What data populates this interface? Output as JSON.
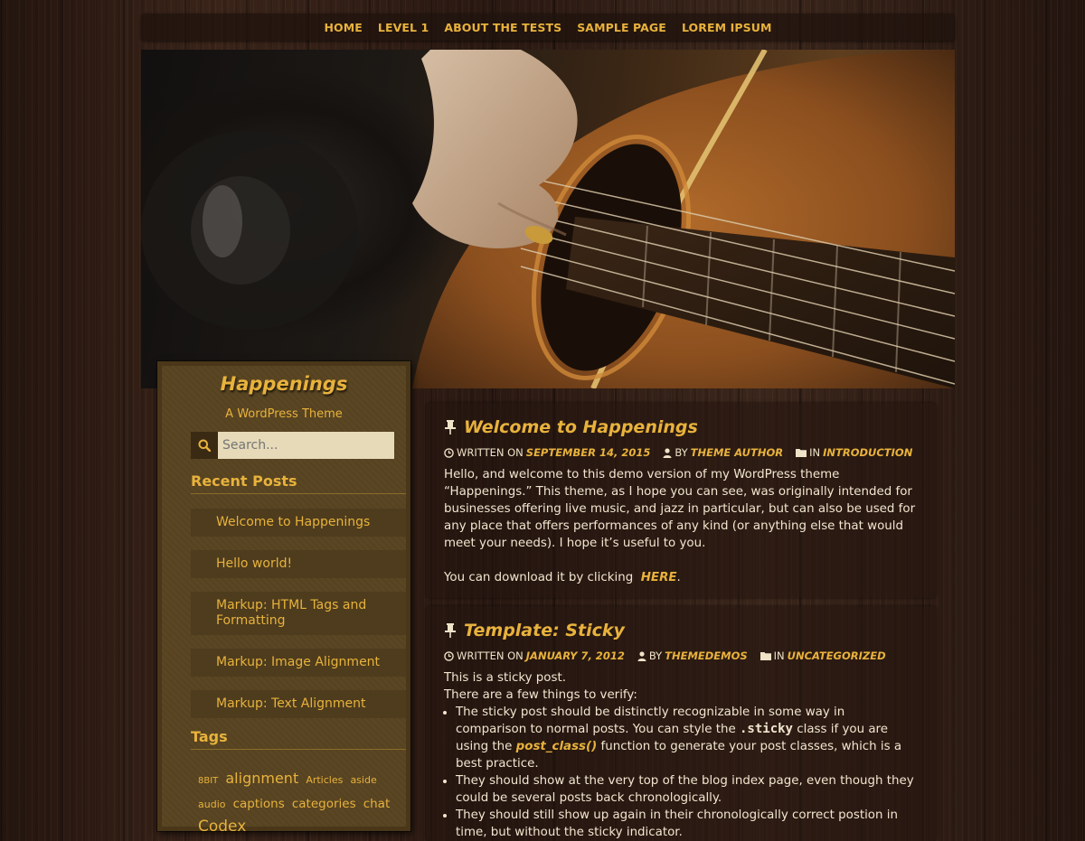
{
  "nav": {
    "items": [
      "HOME",
      "LEVEL 1",
      "ABOUT THE TESTS",
      "SAMPLE PAGE",
      "LOREM IPSUM"
    ]
  },
  "site": {
    "title": "Happenings",
    "tagline": "A WordPress Theme"
  },
  "search": {
    "placeholder": "Search...",
    "icon": "search-icon"
  },
  "recent_posts": {
    "title": "Recent Posts",
    "items": [
      "Welcome to Happenings",
      "Hello world!",
      "Markup: HTML Tags and Formatting",
      "Markup: Image Alignment",
      "Markup: Text Alignment"
    ]
  },
  "tags": {
    "title": "Tags",
    "items": [
      "8BIT",
      "alignment",
      "Articles",
      "aside",
      "audio",
      "captions",
      "categories",
      "chat",
      "Codex"
    ]
  },
  "posts": [
    {
      "title": "Welcome to Happenings",
      "meta": {
        "written_on_label": "WRITTEN ON",
        "date": "SEPTEMBER 14, 2015",
        "by_label": "BY",
        "author": "THEME AUTHOR",
        "in_label": "IN",
        "category": "INTRODUCTION"
      },
      "paragraph1": "Hello, and welcome to this demo version of my WordPress theme “Happenings.” This theme, as I hope you can see, was originally intended for businesses offering live music, and jazz in particular, but can also be used for any place that offers performances of any kind (or anything else that would meet your needs). I hope it’s useful to you.",
      "paragraph2_prefix": "You can download it by clicking",
      "paragraph2_link": "HERE",
      "paragraph2_suffix": "."
    },
    {
      "title": "Template: Sticky",
      "meta": {
        "written_on_label": "WRITTEN ON",
        "date": "JANUARY 7, 2012",
        "by_label": "BY",
        "author": "THEMEDEMOS",
        "in_label": "IN",
        "category": "UNCATEGORIZED"
      },
      "line1": "This is a sticky post.",
      "line2": "There are a few things to verify:",
      "bullet1_a": "The sticky post should be distinctly recognizable in some way in comparison to normal posts. You can style the",
      "bullet1_code": ".sticky",
      "bullet1_b": "class if you are using the",
      "bullet1_link": "post_class()",
      "bullet1_c": "function to generate your post classes, which is a best practice.",
      "bullet2": "They should show at the very top of the blog index page, even though they could be several posts back chronologically.",
      "bullet3": "They should still show up again in their chronologically correct postion in time, but without the sticky indicator."
    }
  ],
  "colors": {
    "accent": "#e8b23c",
    "background": "#2b1a14",
    "sidebar": "#5a4623",
    "text": "#f1e6cf"
  }
}
